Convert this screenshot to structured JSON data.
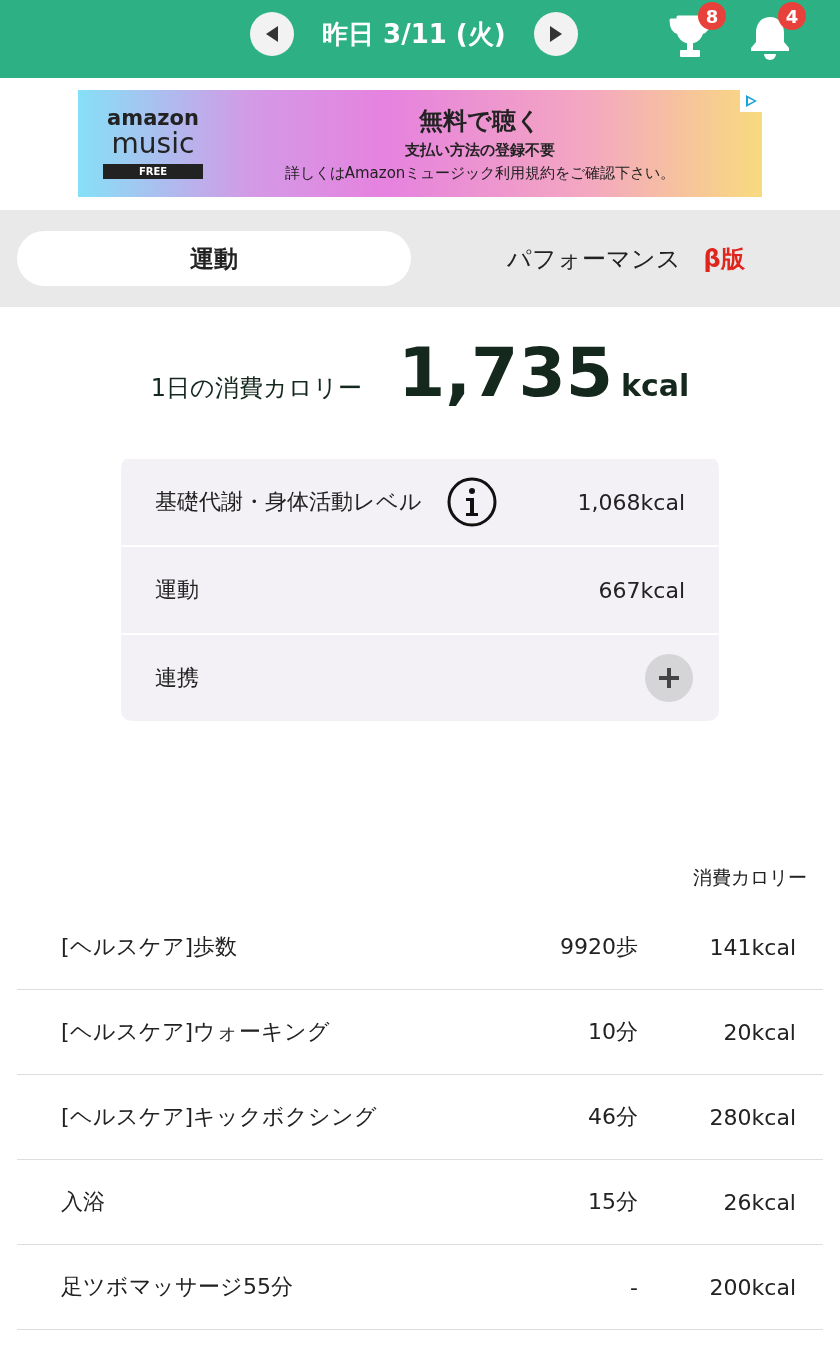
{
  "header": {
    "date": "昨日 3/11 (火)",
    "trophy_badge": "8",
    "bell_badge": "4"
  },
  "ad": {
    "logo_top": "amazon",
    "logo_bottom": "music",
    "logo_tag": "FREE",
    "headline": "無料で聴く",
    "subline": "支払い方法の登録不要",
    "note": "詳しくはAmazonミュージック利用規約をご確認下さい。"
  },
  "tabs": [
    {
      "label": "運動",
      "selected": true
    },
    {
      "label": "パフォーマンス",
      "badge": "β版",
      "selected": false
    }
  ],
  "total": {
    "label": "1日の消費カロリー",
    "value": "1,735",
    "unit": "kcal"
  },
  "breakdown": [
    {
      "kind": "info",
      "label": "基礎代謝・身体活動レベル",
      "value": "1,068kcal"
    },
    {
      "kind": "plain",
      "label": "運動",
      "value": "667kcal"
    },
    {
      "kind": "add",
      "label": "連携"
    }
  ],
  "activities": {
    "column_header": "消費カロリー",
    "rows": [
      {
        "name": "[ヘルスケア]歩数",
        "amount": "9920歩",
        "calories": "141kcal"
      },
      {
        "name": "[ヘルスケア]ウォーキング",
        "amount": "10分",
        "calories": "20kcal"
      },
      {
        "name": "[ヘルスケア]キックボクシング",
        "amount": "46分",
        "calories": "280kcal"
      },
      {
        "name": "入浴",
        "amount": "15分",
        "calories": "26kcal"
      },
      {
        "name": "足ツボマッサージ55分",
        "amount": "-",
        "calories": "200kcal"
      }
    ]
  }
}
